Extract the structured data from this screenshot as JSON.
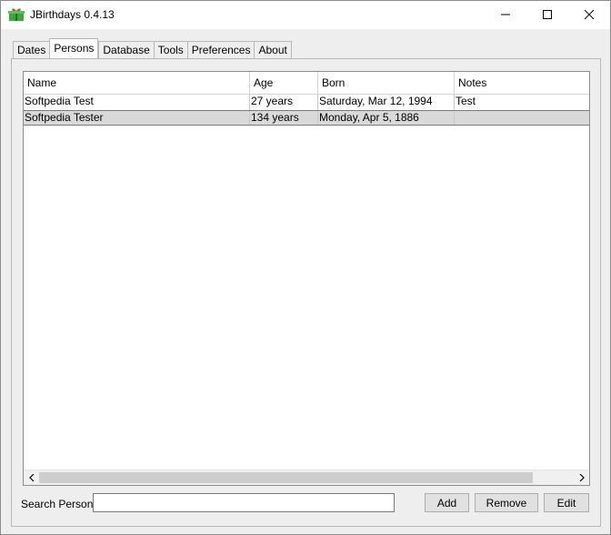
{
  "window": {
    "title": "JBirthdays 0.4.13",
    "icon": "gift-icon",
    "controls": [
      "minimize-icon",
      "maximize-icon",
      "close-icon"
    ]
  },
  "tabs": [
    {
      "label": "Dates"
    },
    {
      "label": "Persons",
      "active": true
    },
    {
      "label": "Database"
    },
    {
      "label": "Tools"
    },
    {
      "label": "Preferences"
    },
    {
      "label": "About"
    }
  ],
  "table": {
    "columns": [
      "Name",
      "Age",
      "Born",
      "Notes"
    ],
    "rows": [
      {
        "name": "Softpedia Test",
        "age": "27 years",
        "born": "Saturday, Mar 12, 1994",
        "notes": "Test"
      },
      {
        "name": "Softpedia Tester",
        "age": "134 years",
        "born": "Monday, Apr 5, 1886",
        "notes": "",
        "selected": true
      }
    ]
  },
  "search": {
    "label": "Search Person:",
    "value": ""
  },
  "buttons": {
    "add": "Add",
    "remove": "Remove",
    "edit": "Edit"
  }
}
